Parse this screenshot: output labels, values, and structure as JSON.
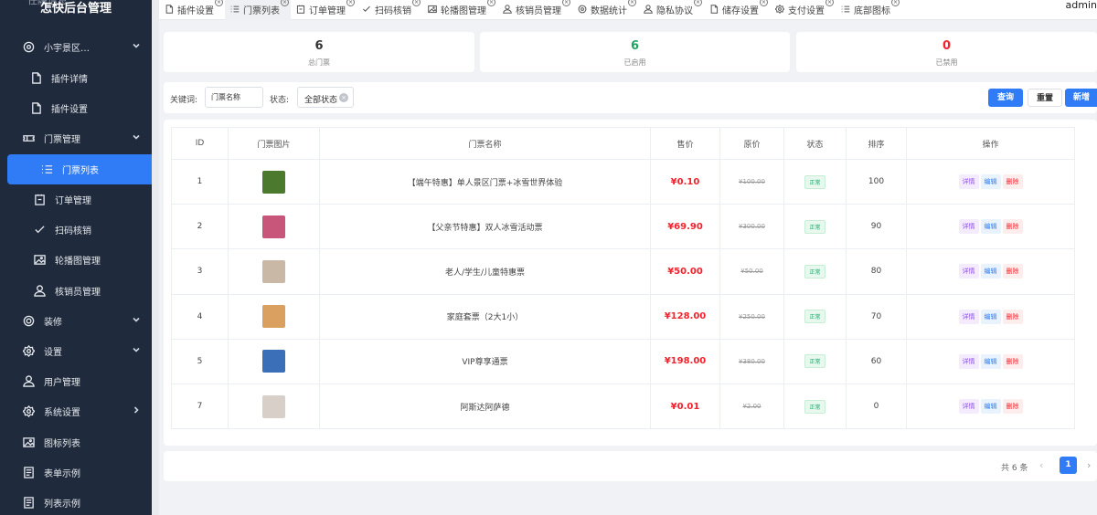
{
  "sidebar": {
    "brand": "怎快后台管理",
    "brand_ghost": "任融信息",
    "items": [
      {
        "label": "小宇景区…",
        "icon": "settings-icon"
      },
      {
        "label": "插件详情",
        "icon": "file-icon"
      },
      {
        "label": "插件设置",
        "icon": "file-icon"
      },
      {
        "label": "门票管理",
        "icon": "ticket-icon"
      },
      {
        "label": "门票列表",
        "icon": "list-icon"
      },
      {
        "label": "订单管理",
        "icon": "order-icon"
      },
      {
        "label": "扫码核销",
        "icon": "check-icon"
      },
      {
        "label": "轮播图管理",
        "icon": "image-icon"
      },
      {
        "label": "核销员管理",
        "icon": "user-icon"
      },
      {
        "label": "装修",
        "icon": "palette-icon"
      },
      {
        "label": "设置",
        "icon": "gear-icon"
      },
      {
        "label": "用户管理",
        "icon": "user-icon"
      },
      {
        "label": "系统设置",
        "icon": "gear-icon"
      },
      {
        "label": "图标列表",
        "icon": "image-icon"
      },
      {
        "label": "表单示例",
        "icon": "form-icon"
      },
      {
        "label": "列表示例",
        "icon": "form-icon"
      }
    ]
  },
  "tabs": [
    {
      "label": "插件设置",
      "icon": "file-icon"
    },
    {
      "label": "门票列表",
      "icon": "list-icon"
    },
    {
      "label": "订单管理",
      "icon": "order-icon"
    },
    {
      "label": "扫码核销",
      "icon": "check-icon"
    },
    {
      "label": "轮播图管理",
      "icon": "image-icon"
    },
    {
      "label": "核销员管理",
      "icon": "user-icon"
    },
    {
      "label": "数据统计",
      "icon": "settings-icon"
    },
    {
      "label": "隐私协议",
      "icon": "user-icon"
    },
    {
      "label": "储存设置",
      "icon": "file-icon"
    },
    {
      "label": "支付设置",
      "icon": "gear-icon"
    },
    {
      "label": "底部图标",
      "icon": "list-icon"
    }
  ],
  "tab_close_glyph": "×",
  "user": "admin",
  "stats": [
    {
      "value": "6",
      "label": "总门票",
      "color": "#333333"
    },
    {
      "value": "6",
      "label": "已启用",
      "color": "#21a366"
    },
    {
      "value": "0",
      "label": "已禁用",
      "color": "#f5222d"
    }
  ],
  "filter": {
    "keyword_label": "关键词:",
    "keyword_value": "门票名称",
    "status_label": "状态:",
    "status_value": "全部状态",
    "clear_glyph": "×",
    "search_label": "查询",
    "reset_label": "重置",
    "add_label": "新增"
  },
  "table": {
    "headers": [
      "ID",
      "门票图片",
      "门票名称",
      "售价",
      "原价",
      "状态",
      "排序",
      "操作"
    ],
    "rows": [
      {
        "id": "1",
        "name": "【端午特惠】单人景区门票+冰雪世界体验",
        "price": "¥0.10",
        "orig": "¥100.00",
        "status": "正常",
        "sort": "100",
        "thumb": "#4b7a2f"
      },
      {
        "id": "2",
        "name": "【父亲节特惠】双人冰雪活动票",
        "price": "¥69.90",
        "orig": "¥300.00",
        "status": "正常",
        "sort": "90",
        "thumb": "#c8557a"
      },
      {
        "id": "3",
        "name": "老人/学生/儿童特惠票",
        "price": "¥50.00",
        "orig": "¥50.00",
        "status": "正常",
        "sort": "80",
        "thumb": "#c9b8a6"
      },
      {
        "id": "4",
        "name": "家庭套票（2大1小）",
        "price": "¥128.00",
        "orig": "¥250.00",
        "status": "正常",
        "sort": "70",
        "thumb": "#d9a05f"
      },
      {
        "id": "5",
        "name": "VIP尊享通票",
        "price": "¥198.00",
        "orig": "¥380.00",
        "status": "正常",
        "sort": "60",
        "thumb": "#3b6fb8"
      },
      {
        "id": "7",
        "name": "阿斯达阿萨德",
        "price": "¥0.01",
        "orig": "¥2.00",
        "status": "正常",
        "sort": "0",
        "thumb": "#d8cfc8"
      }
    ],
    "actions": {
      "detail": "详情",
      "edit": "编辑",
      "delete": "删除"
    }
  },
  "pager": {
    "total": "共 6 条",
    "page": "1",
    "prev": "‹",
    "next": "›"
  }
}
